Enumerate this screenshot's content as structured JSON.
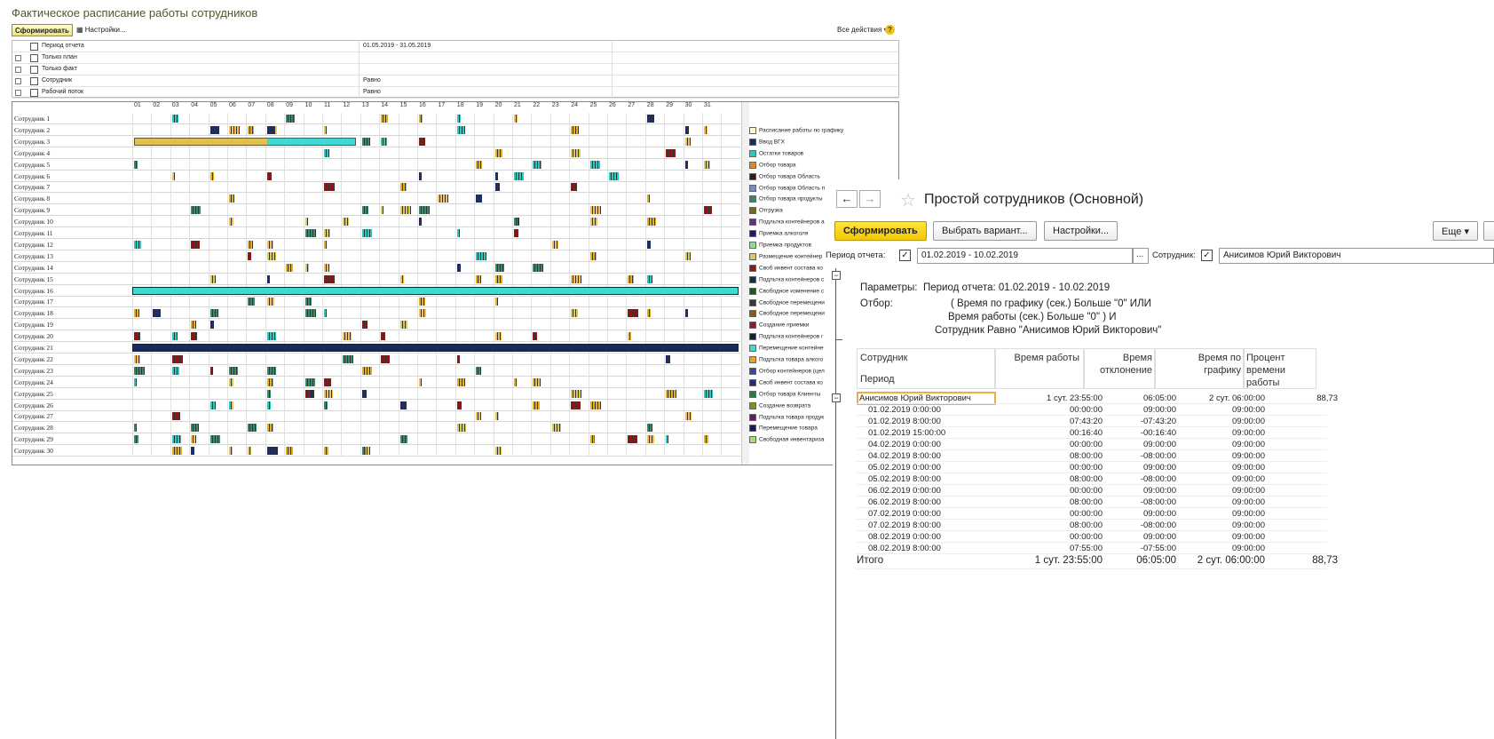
{
  "win1": {
    "title": "Фактическое расписание работы сотрудников",
    "form_btn": "Сформировать",
    "settings_btn": "Настройки...",
    "all_actions": "Все действия",
    "params": [
      {
        "label": "Период отчета",
        "value": "01.05.2019 - 31.05.2019",
        "checkbox": false
      },
      {
        "label": "Только план",
        "value": "",
        "checkbox": true
      },
      {
        "label": "Только факт",
        "value": "",
        "checkbox": true
      },
      {
        "label": "Сотрудник",
        "value": "Равно",
        "checkbox": true
      },
      {
        "label": "Рабочий поток",
        "value": "Равно",
        "checkbox": true
      }
    ],
    "days": [
      "01",
      "02",
      "03",
      "04",
      "05",
      "06",
      "07",
      "08",
      "09",
      "10",
      "11",
      "12",
      "13",
      "14",
      "15",
      "16",
      "17",
      "18",
      "19",
      "20",
      "21",
      "22",
      "23",
      "24",
      "25",
      "26",
      "27",
      "28",
      "29",
      "30",
      "31"
    ],
    "employees": [
      "Сотрудник 1",
      "Сотрудник 2",
      "Сотрудник 3",
      "Сотрудник 4",
      "Сотрудник 5",
      "Сотрудник 6",
      "Сотрудник 7",
      "Сотрудник 8",
      "Сотрудник 9",
      "Сотрудник 10",
      "Сотрудник 11",
      "Сотрудник 12",
      "Сотрудник 13",
      "Сотрудник 14",
      "Сотрудник 15",
      "Сотрудник 16",
      "Сотрудник 17",
      "Сотрудник 18",
      "Сотрудник 19",
      "Сотрудник 20",
      "Сотрудник 21",
      "Сотрудник 22",
      "Сотрудник 23",
      "Сотрудник 24",
      "Сотрудник 25",
      "Сотрудник 26",
      "Сотрудник 27",
      "Сотрудник 28",
      "Сотрудник 29",
      "Сотрудник 30"
    ],
    "legend": [
      {
        "label": "Расписание работы по графику",
        "color": "#fffbc8"
      },
      {
        "label": "Ввод ВГХ",
        "color": "#1a2a6a"
      },
      {
        "label": "Остатки товаров",
        "color": "#2cc8c0"
      },
      {
        "label": "Отбор товара",
        "color": "#e08a20"
      },
      {
        "label": "Отбор товара Область",
        "color": "#3a1a10"
      },
      {
        "label": "Отбор товара Область п",
        "color": "#7a8ad0"
      },
      {
        "label": "Отбор товара продукты",
        "color": "#3a8a6a"
      },
      {
        "label": "Отгрузка",
        "color": "#6a6a20"
      },
      {
        "label": "Подльтка контейнеров а",
        "color": "#6a2a8a"
      },
      {
        "label": "Приемка алкоголя",
        "color": "#1a1a6a"
      },
      {
        "label": "Приемка продуктов",
        "color": "#8ae08a"
      },
      {
        "label": "Размещение контейнер",
        "color": "#d8c860"
      },
      {
        "label": "Своб инвент состава ко",
        "color": "#8a1a1a"
      },
      {
        "label": "Подльтка контейнеров с",
        "color": "#1a2a4a"
      },
      {
        "label": "Свободное изменение с",
        "color": "#1a5a1a"
      },
      {
        "label": "Свободное перемещени",
        "color": "#3a3a3a"
      },
      {
        "label": "Свободное перемещени",
        "color": "#8a5a1a"
      },
      {
        "label": "Создание приемки",
        "color": "#8a1a3a"
      },
      {
        "label": "Подльтка контейнеров г",
        "color": "#1a1a3a"
      },
      {
        "label": "Перемещение контейне",
        "color": "#40d8d0"
      },
      {
        "label": "Подльтка товара алкого",
        "color": "#f0a020"
      },
      {
        "label": "Отбор контейнеров (цел",
        "color": "#3a4a9a"
      },
      {
        "label": "Своб инвент состава ко",
        "color": "#2a2a7a"
      },
      {
        "label": "Отбор товара Клиенты",
        "color": "#2a7a4a"
      },
      {
        "label": "Создание возврата",
        "color": "#8a8a1a"
      },
      {
        "label": "Подльтка товара продук",
        "color": "#6a1a6a"
      },
      {
        "label": "Перемещение товара",
        "color": "#1a1a5a"
      },
      {
        "label": "Свободная инвентариза",
        "color": "#a0e070"
      }
    ],
    "colors": {
      "title": "#4a5a2e",
      "accent": "#f2e27a"
    }
  },
  "win2": {
    "title": "Простой сотрудников (Основной)",
    "form_btn": "Сформировать",
    "variant_btn": "Выбрать вариант...",
    "settings_btn": "Настройки...",
    "more_btn": "Еще",
    "period_label": "Период отчета:",
    "period_value": "01.02.2019 - 10.02.2019",
    "period_dots": "...",
    "emp_label": "Сотрудник:",
    "emp_value": "Анисимов Юрий Викторович",
    "params_label": "Параметры:",
    "params_value": "Период отчета: 01.02.2019 - 10.02.2019",
    "filter_label": "Отбор:",
    "filter_line1": "( Время по графику (сек.) Больше \"0\" ИЛИ",
    "filter_line2": "Время работы (сек.) Больше \"0\" ) И",
    "filter_line3": "Сотрудник Равно \"Анисимов Юрий Викторович\"",
    "col_emp": "Сотрудник",
    "col_period": "Период",
    "col_work": "Время работы",
    "col_dev1": "Время",
    "col_dev2": "отклонение",
    "col_sched1": "Время по",
    "col_sched2": "графику",
    "col_pct1": "Процент",
    "col_pct2": "времени",
    "col_pct3": "работы",
    "group": {
      "name": "Анисимов Юрий Викторович",
      "work": "1 сут. 23:55:00",
      "dev": "06:05:00",
      "sched": "2 сут. 06:00:00",
      "pct": "88,73"
    },
    "rows": [
      {
        "p": "01.02.2019 0:00:00",
        "w": "00:00:00",
        "d": "09:00:00",
        "s": "09:00:00"
      },
      {
        "p": "01.02.2019 8:00:00",
        "w": "07:43:20",
        "d": "-07:43:20",
        "s": "09:00:00"
      },
      {
        "p": "01.02.2019 15:00:00",
        "w": "00:16:40",
        "d": "-00:16:40",
        "s": "09:00:00"
      },
      {
        "p": "04.02.2019 0:00:00",
        "w": "00:00:00",
        "d": "09:00:00",
        "s": "09:00:00"
      },
      {
        "p": "04.02.2019 8:00:00",
        "w": "08:00:00",
        "d": "-08:00:00",
        "s": "09:00:00"
      },
      {
        "p": "05.02.2019 0:00:00",
        "w": "00:00:00",
        "d": "09:00:00",
        "s": "09:00:00"
      },
      {
        "p": "05.02.2019 8:00:00",
        "w": "08:00:00",
        "d": "-08:00:00",
        "s": "09:00:00"
      },
      {
        "p": "06.02.2019 0:00:00",
        "w": "00:00:00",
        "d": "09:00:00",
        "s": "09:00:00"
      },
      {
        "p": "06.02.2019 8:00:00",
        "w": "08:00:00",
        "d": "-08:00:00",
        "s": "09:00:00"
      },
      {
        "p": "07.02.2019 0:00:00",
        "w": "00:00:00",
        "d": "09:00:00",
        "s": "09:00:00"
      },
      {
        "p": "07.02.2019 8:00:00",
        "w": "08:00:00",
        "d": "-08:00:00",
        "s": "09:00:00"
      },
      {
        "p": "08.02.2019 0:00:00",
        "w": "00:00:00",
        "d": "09:00:00",
        "s": "09:00:00"
      },
      {
        "p": "08.02.2019 8:00:00",
        "w": "07:55:00",
        "d": "-07:55:00",
        "s": "09:00:00"
      }
    ],
    "total": {
      "label": "Итого",
      "work": "1 сут. 23:55:00",
      "dev": "06:05:00",
      "sched": "2 сут. 06:00:00",
      "pct": "88,73"
    }
  }
}
